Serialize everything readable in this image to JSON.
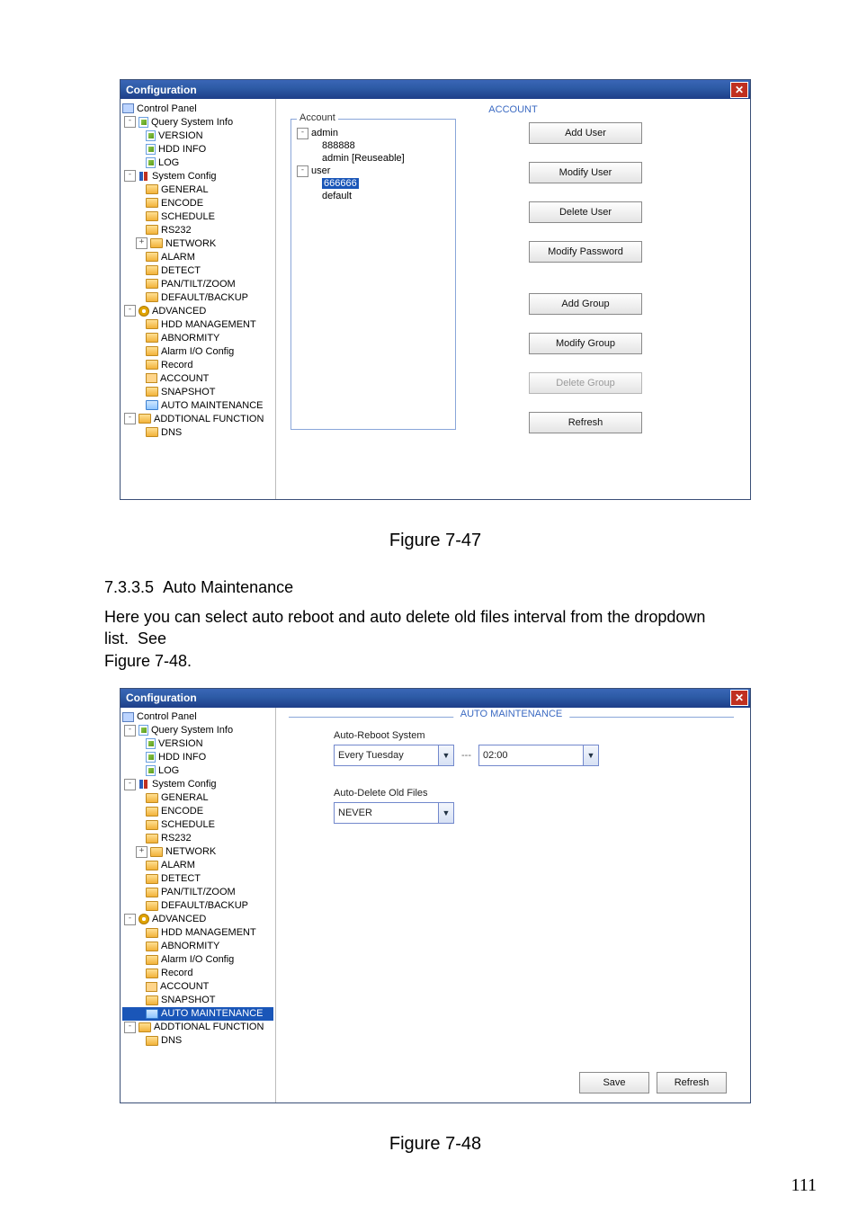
{
  "window_title": "Configuration",
  "fig1": {
    "panel_title": "ACCOUNT",
    "fieldset_legend": "Account",
    "accounts": {
      "group1": "admin",
      "g1users": [
        "888888",
        "admin [Reuseable]"
      ],
      "group2": "user",
      "g2users": [
        "666666",
        "default"
      ]
    },
    "buttons": {
      "add_user": "Add User",
      "modify_user": "Modify User",
      "delete_user": "Delete User",
      "modify_password": "Modify Password",
      "add_group": "Add Group",
      "modify_group": "Modify Group",
      "delete_group": "Delete Group",
      "refresh": "Refresh"
    }
  },
  "caption1": "Figure 7-47",
  "section_number": "7.3.3.5",
  "section_title": "Auto Maintenance",
  "section_body1": "Here you can select auto reboot and auto delete old files interval from the dropdown list.",
  "section_body_see": "See",
  "section_body2": "Figure 7-48.",
  "fig2": {
    "panel_title": "AUTO MAINTENANCE",
    "label_reboot": "Auto-Reboot System",
    "reboot_day": "Every Tuesday",
    "dashes": "---",
    "reboot_time": "02:00",
    "label_delete": "Auto-Delete Old Files",
    "delete_value": "NEVER",
    "save": "Save",
    "refresh": "Refresh"
  },
  "caption2": "Figure 7-48",
  "page_number": "111",
  "tree": {
    "root": "Control Panel",
    "n1": "Query System Info",
    "n1_children": [
      "VERSION",
      "HDD INFO",
      "LOG"
    ],
    "n2": "System Config",
    "n2_children": [
      "GENERAL",
      "ENCODE",
      "SCHEDULE",
      "RS232",
      "NETWORK",
      "ALARM",
      "DETECT",
      "PAN/TILT/ZOOM",
      "DEFAULT/BACKUP"
    ],
    "n3": "ADVANCED",
    "n3_children": [
      "HDD MANAGEMENT",
      "ABNORMITY",
      "Alarm I/O Config",
      "Record",
      "ACCOUNT",
      "SNAPSHOT",
      "AUTO MAINTENANCE"
    ],
    "n4": "ADDTIONAL FUNCTION",
    "n4_children": [
      "DNS"
    ]
  }
}
